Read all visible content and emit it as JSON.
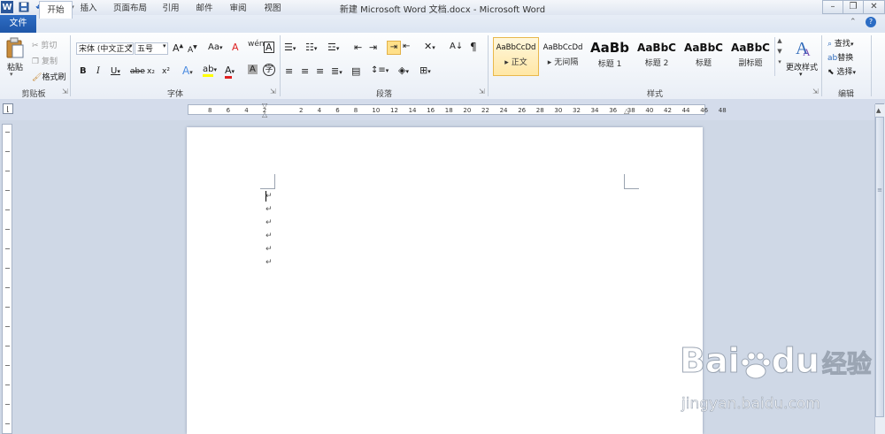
{
  "window": {
    "title": "新建 Microsoft Word 文档.docx - Microsoft Word"
  },
  "quick_access": {
    "app_icon": "W",
    "save_icon": "save-icon",
    "undo": "↶",
    "redo": "↻"
  },
  "tabs": [
    "文件",
    "开始",
    "插入",
    "页面布局",
    "引用",
    "邮件",
    "审阅",
    "视图"
  ],
  "clipboard": {
    "label": "剪贴板",
    "paste": "粘贴",
    "cut": "剪切",
    "copy": "复制",
    "format_painter": "格式刷"
  },
  "font": {
    "label": "字体",
    "name": "宋体 (中文正文",
    "size": "五号",
    "grow": "A",
    "shrink": "A",
    "case": "Aa",
    "clear": "A",
    "phonetic": "wén",
    "char_border": "A",
    "bold": "B",
    "italic": "I",
    "underline": "U",
    "strike": "abe",
    "sub": "x₂",
    "sup": "x²",
    "text_effect": "A",
    "highlight": "ab",
    "font_color": "A",
    "char_shading": "A",
    "enclose": "字"
  },
  "paragraph": {
    "label": "段落",
    "sort": "A↓",
    "show_marks": "¶"
  },
  "styles": {
    "label": "样式",
    "items": [
      {
        "sample": "AaBbCcDd",
        "name": "正文"
      },
      {
        "sample": "AaBbCcDd",
        "name": "无间隔"
      },
      {
        "sample": "AaBb",
        "name": "标题 1"
      },
      {
        "sample": "AaBbC",
        "name": "标题 2"
      },
      {
        "sample": "AaBbC",
        "name": "标题"
      },
      {
        "sample": "AaBbC",
        "name": "副标题"
      }
    ],
    "change_styles": "更改样式"
  },
  "editing": {
    "label": "编辑",
    "find": "查找",
    "replace": "替换",
    "select": "选择"
  },
  "ruler": {
    "ticks": [
      "8",
      "6",
      "4",
      "2",
      "",
      "2",
      "4",
      "6",
      "8",
      "10",
      "12",
      "14",
      "16",
      "18",
      "20",
      "22",
      "24",
      "26",
      "28",
      "30",
      "32",
      "34",
      "36",
      "38",
      "40",
      "42",
      "44",
      "46",
      "48"
    ]
  },
  "document": {
    "paragraph_marks": [
      "↵",
      "↵",
      "↵",
      "↵",
      "↵",
      "↵"
    ]
  },
  "watermark": {
    "logo": "Bai",
    "logo_suffix": "du",
    "brand": "经验",
    "url": "jingyan.baidu.com"
  },
  "colors": {
    "file_tab": "#1e56a8",
    "accent": "#2b579a",
    "highlight": "#ffff00",
    "font_color": "#e02020"
  }
}
